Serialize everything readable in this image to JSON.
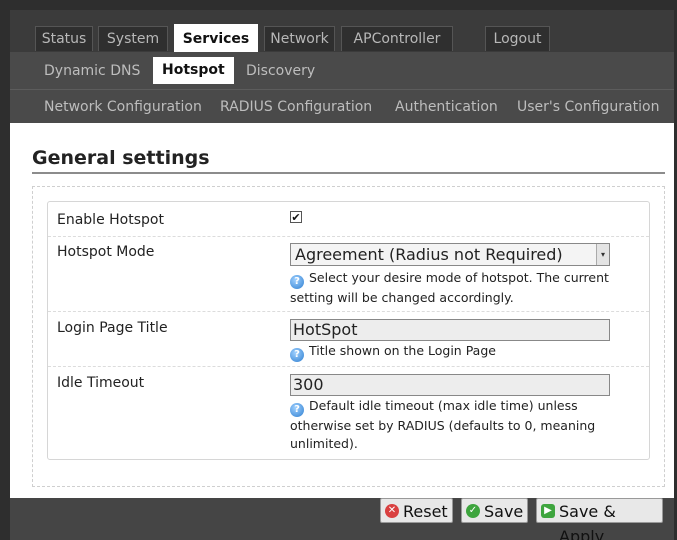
{
  "top_tabs": [
    {
      "label": "Status"
    },
    {
      "label": "System"
    },
    {
      "label": "Services"
    },
    {
      "label": "Network"
    },
    {
      "label": "APController"
    },
    {
      "label": "Logout"
    }
  ],
  "sub_tabs": [
    {
      "label": "Dynamic DNS"
    },
    {
      "label": "Hotspot"
    },
    {
      "label": "Discovery"
    }
  ],
  "third_tabs": [
    {
      "label": "Network Configuration"
    },
    {
      "label": "RADIUS Configuration"
    },
    {
      "label": "Authentication"
    },
    {
      "label": "User's Configuration"
    }
  ],
  "section_title": "General settings",
  "form": {
    "enable_hotspot": {
      "label": "Enable Hotspot",
      "checked": true
    },
    "hotspot_mode": {
      "label": "Hotspot Mode",
      "value": "Agreement (Radius not Required)",
      "hint": "Select your desire mode of hotspot. The current setting will be changed accordingly."
    },
    "login_page_title": {
      "label": "Login Page Title",
      "value": "HotSpot",
      "hint": "Title shown on the Login Page"
    },
    "idle_timeout": {
      "label": "Idle Timeout",
      "value": "300",
      "hint": "Default idle timeout (max idle time) unless otherwise set by RADIUS (defaults to 0, meaning unlimited)."
    }
  },
  "buttons": {
    "reset": "Reset",
    "save": "Save",
    "save_apply": "Save & Apply"
  },
  "icons": {
    "help": "help-icon",
    "reset": "reset-icon",
    "save": "save-icon",
    "apply": "apply-icon"
  },
  "colors": {
    "background": "#2e2e2e",
    "active_tab": "#ffffff",
    "inactive_tab_text": "#b8b8b8"
  }
}
